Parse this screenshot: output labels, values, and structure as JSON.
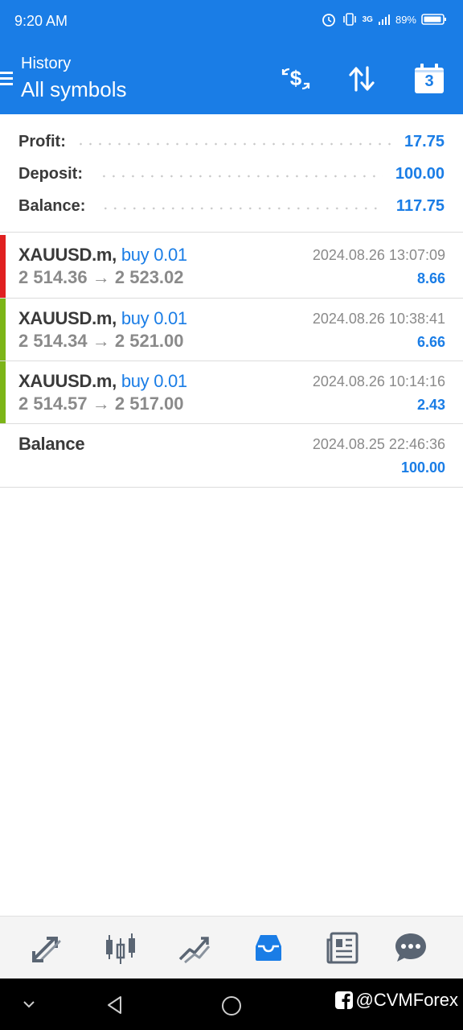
{
  "status_bar": {
    "time": "9:20 AM",
    "network": "3G",
    "battery": "89%"
  },
  "header": {
    "subtitle": "History",
    "title": "All symbols",
    "calendar_day": "3"
  },
  "summary": [
    {
      "label": "Profit:",
      "value": "17.75"
    },
    {
      "label": "Deposit:",
      "value": "100.00"
    },
    {
      "label": "Balance:",
      "value": "117.75"
    }
  ],
  "deals": [
    {
      "symbol": "XAUUSD.m,",
      "action": "buy 0.01",
      "open_price": "2 514.36",
      "close_price": "2 523.02",
      "time": "2024.08.26 13:07:09",
      "profit": "8.66",
      "marker_color": "#e02020"
    },
    {
      "symbol": "XAUUSD.m,",
      "action": "buy 0.01",
      "open_price": "2 514.34",
      "close_price": "2 521.00",
      "time": "2024.08.26 10:38:41",
      "profit": "6.66",
      "marker_color": "#7cb518"
    },
    {
      "symbol": "XAUUSD.m,",
      "action": "buy 0.01",
      "open_price": "2 514.57",
      "close_price": "2 517.00",
      "time": "2024.08.26 10:14:16",
      "profit": "2.43",
      "marker_color": "#7cb518"
    }
  ],
  "balance_entry": {
    "label": "Balance",
    "time": "2024.08.25 22:46:36",
    "amount": "100.00"
  },
  "bottom_nav": [
    "quotes-icon",
    "chart-icon",
    "trade-icon",
    "history-icon",
    "news-icon",
    "messages-icon"
  ],
  "watermark": "@CVMForex",
  "colors": {
    "accent": "#1a7de6",
    "loss_marker": "#e02020",
    "profit_marker": "#7cb518"
  }
}
